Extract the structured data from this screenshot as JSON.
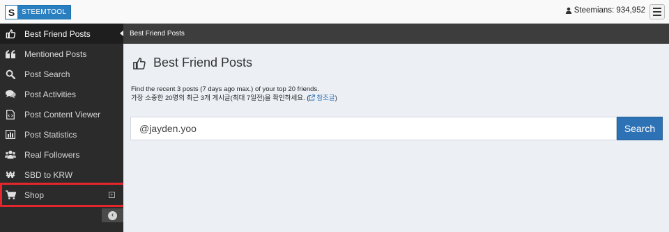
{
  "brand": {
    "letter": "S",
    "name": "STEEMTOOL"
  },
  "header": {
    "steemians": "Steemians: 934,952"
  },
  "sidebar": {
    "items": [
      {
        "label": "Best Friend Posts",
        "icon": "thumbs-up-icon",
        "active": true
      },
      {
        "label": "Mentioned Posts",
        "icon": "quote-icon"
      },
      {
        "label": "Post Search",
        "icon": "search-icon"
      },
      {
        "label": "Post Activities",
        "icon": "comments-icon"
      },
      {
        "label": "Post Content Viewer",
        "icon": "file-code-icon"
      },
      {
        "label": "Post Statistics",
        "icon": "bar-chart-icon"
      },
      {
        "label": "Real Followers",
        "icon": "users-icon"
      },
      {
        "label": "SBD to KRW",
        "icon": "won-icon"
      },
      {
        "label": "Shop",
        "icon": "cart-icon",
        "expandable": true
      }
    ]
  },
  "breadcrumb": {
    "label": "Best Friend Posts"
  },
  "main": {
    "title": "Best Friend Posts",
    "desc_en": "Find the recent 3 posts (7 days ago max.) of your top 20 friends.",
    "desc_kr_prefix": "가장 소중한 20명의 최근 3개 게시글(최대 7일전)을 확인하세요. (",
    "desc_kr_link": "참조글",
    "desc_kr_suffix": ")",
    "search_value": "@jayden.yoo",
    "search_button": "Search"
  },
  "colors": {
    "accent": "#2d72b5",
    "sidebar": "#2b2b2b",
    "highlight": "#e5262c"
  }
}
